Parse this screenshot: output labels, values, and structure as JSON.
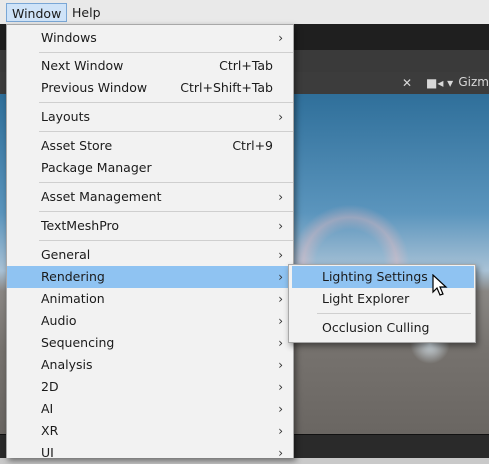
{
  "menubar": {
    "window": "Window",
    "help": "Help"
  },
  "scene_toolbar": {
    "gizmos": "Gizm"
  },
  "window_menu": {
    "items": [
      {
        "label": "Windows",
        "shortcut": "",
        "submenu": true
      },
      {
        "label": "Next Window",
        "shortcut": "Ctrl+Tab",
        "submenu": false
      },
      {
        "label": "Previous Window",
        "shortcut": "Ctrl+Shift+Tab",
        "submenu": false
      },
      {
        "label": "Layouts",
        "shortcut": "",
        "submenu": true
      },
      {
        "label": "Asset Store",
        "shortcut": "Ctrl+9",
        "submenu": false
      },
      {
        "label": "Package Manager",
        "shortcut": "",
        "submenu": false
      },
      {
        "label": "Asset Management",
        "shortcut": "",
        "submenu": true
      },
      {
        "label": "TextMeshPro",
        "shortcut": "",
        "submenu": true
      },
      {
        "label": "General",
        "shortcut": "",
        "submenu": true
      },
      {
        "label": "Rendering",
        "shortcut": "",
        "submenu": true
      },
      {
        "label": "Animation",
        "shortcut": "",
        "submenu": true
      },
      {
        "label": "Audio",
        "shortcut": "",
        "submenu": true
      },
      {
        "label": "Sequencing",
        "shortcut": "",
        "submenu": true
      },
      {
        "label": "Analysis",
        "shortcut": "",
        "submenu": true
      },
      {
        "label": "2D",
        "shortcut": "",
        "submenu": true
      },
      {
        "label": "AI",
        "shortcut": "",
        "submenu": true
      },
      {
        "label": "XR",
        "shortcut": "",
        "submenu": true
      },
      {
        "label": "UI",
        "shortcut": "",
        "submenu": true
      }
    ],
    "highlighted": "Rendering",
    "arrow_glyph": "›"
  },
  "rendering_submenu": {
    "items": [
      {
        "label": "Lighting Settings"
      },
      {
        "label": "Light Explorer"
      },
      {
        "label": "Occlusion Culling"
      }
    ],
    "highlighted": "Lighting Settings"
  },
  "colors": {
    "highlight": "#8fc3f2",
    "menu_bg": "#f2f2f2",
    "menubar_active": "#cfe3f8"
  }
}
